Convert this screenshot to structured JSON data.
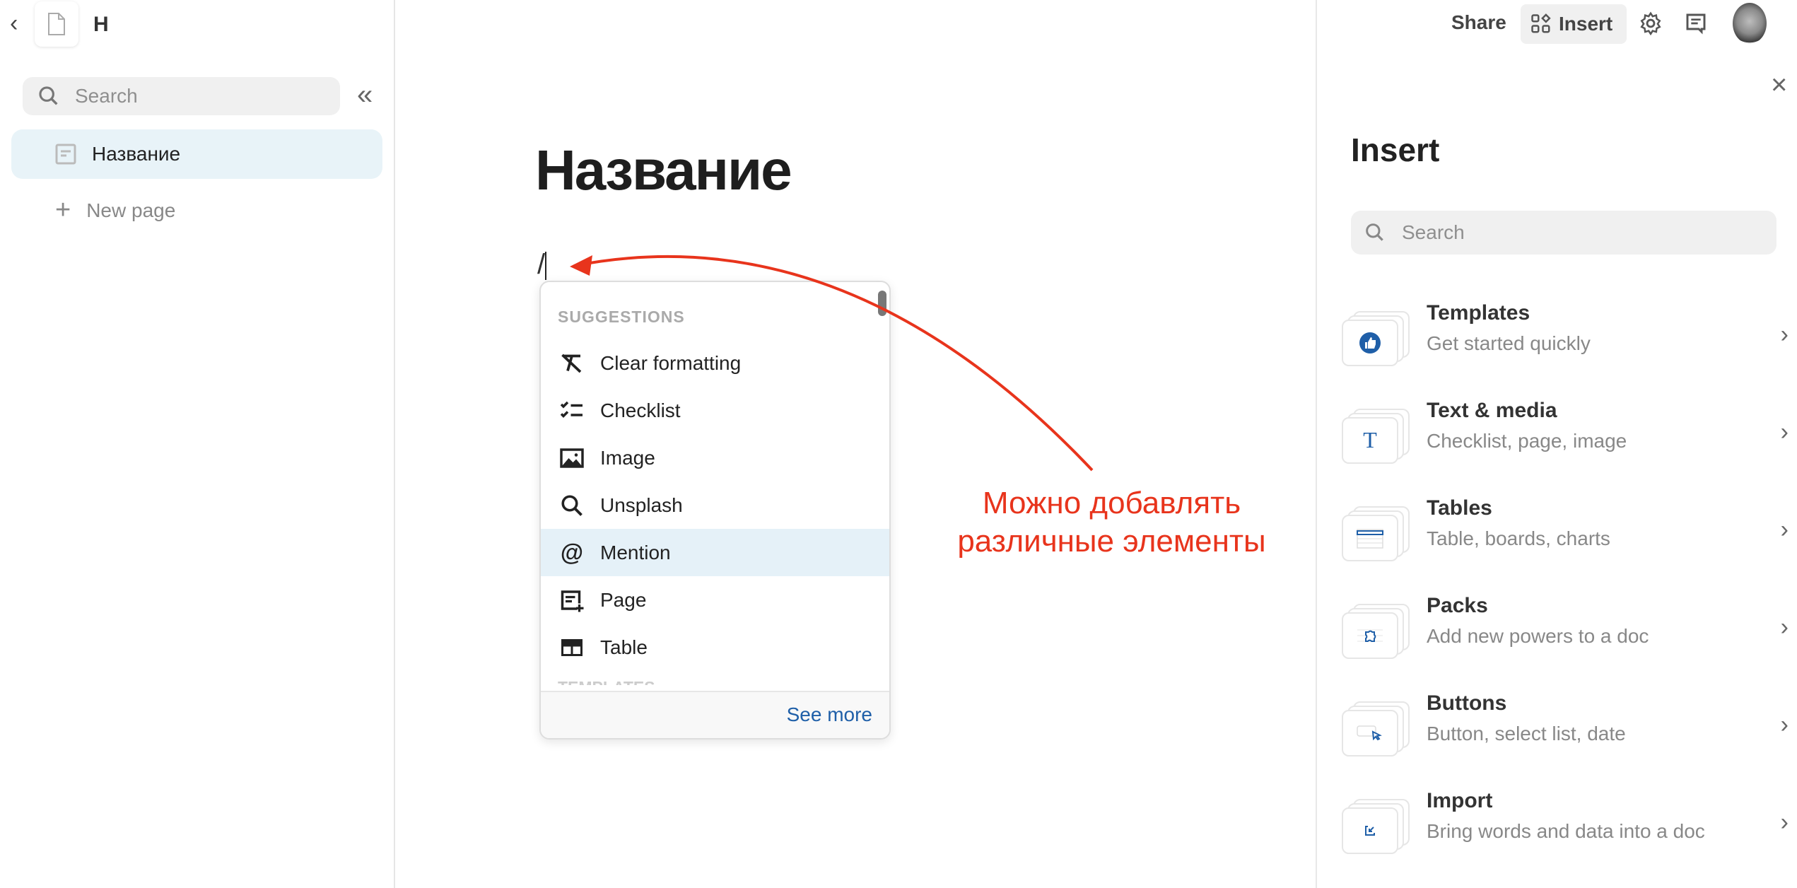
{
  "sidebar": {
    "doc_title": "H",
    "search_placeholder": "Search",
    "pages": [
      {
        "label": "Название",
        "selected": true
      }
    ],
    "new_page": "New page"
  },
  "editor": {
    "title": "Название",
    "typed": "/"
  },
  "slash_menu": {
    "section": "SUGGESTIONS",
    "items": [
      {
        "label": "Clear formatting",
        "icon": "clear-formatting-icon"
      },
      {
        "label": "Checklist",
        "icon": "checklist-icon"
      },
      {
        "label": "Image",
        "icon": "image-icon"
      },
      {
        "label": "Unsplash",
        "icon": "search-icon"
      },
      {
        "label": "Mention",
        "icon": "at-icon",
        "highlighted": true
      },
      {
        "label": "Page",
        "icon": "page-add-icon"
      },
      {
        "label": "Table",
        "icon": "table-icon"
      }
    ],
    "next_section": "TEMPLATES",
    "see_more": "See more"
  },
  "annotation": {
    "line1": "Можно добавлять",
    "line2": "различные элементы",
    "color": "#e8341c"
  },
  "topbar": {
    "share": "Share",
    "insert": "Insert"
  },
  "insert_panel": {
    "title": "Insert",
    "search_placeholder": "Search",
    "items": [
      {
        "title": "Templates",
        "subtitle": "Get started quickly",
        "icon": "thumbs-up-icon"
      },
      {
        "title": "Text & media",
        "subtitle": "Checklist, page, image",
        "icon": "text-icon"
      },
      {
        "title": "Tables",
        "subtitle": "Table, boards, charts",
        "icon": "table-icon"
      },
      {
        "title": "Packs",
        "subtitle": "Add new powers to a doc",
        "icon": "puzzle-icon"
      },
      {
        "title": "Buttons",
        "subtitle": "Button, select list, date",
        "icon": "cursor-button-icon"
      },
      {
        "title": "Import",
        "subtitle": "Bring words and data into a doc",
        "icon": "import-icon"
      }
    ]
  },
  "colors": {
    "accent": "#1f5fa8",
    "highlight": "#e5f1f8",
    "annotation": "#e8341c"
  }
}
